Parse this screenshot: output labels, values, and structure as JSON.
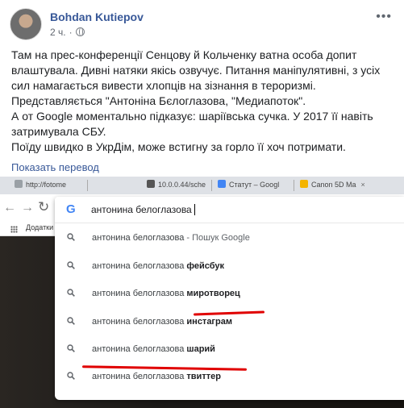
{
  "post": {
    "author": "Bohdan Kutiepov",
    "time": "2 ч.",
    "text_lines": [
      "Там на прес-конференції Сенцову й Кольченку ватна особа допит",
      "влаштувала. Дивні натяки якісь озвучує. Питання маніпулятивні, з усіх",
      "сил намагається вивести хлопців на зізнання в тероризмі.",
      "Представляється \"Антоніна Бєлоглазова, \"Медиапоток\".",
      "А от Google моментально підказує: шаріївська сучка. У 2017 її навіть",
      "затримувала СБУ.",
      "Поїду швидко в УкрДім, може встигну за горло її хоч потримати."
    ],
    "translate_link": "Показать перевод"
  },
  "browser": {
    "tabs": [
      "http://fotome",
      "10.0.0.44/sche",
      "Статут – Googl",
      "Canon 5D Ma"
    ],
    "bookmarks_label": "Додатки",
    "search_query": "антонина белоглазова",
    "suggestions": [
      {
        "base": "антонина белоглазова",
        "suffix": " - Пошук Google",
        "bold": ""
      },
      {
        "base": "антонина белоглазова ",
        "suffix": "",
        "bold": "фейсбук"
      },
      {
        "base": "антонина белоглазова ",
        "suffix": "",
        "bold": "миротворец"
      },
      {
        "base": "антонина белоглазова ",
        "suffix": "",
        "bold": "инстаграм"
      },
      {
        "base": "антонина белоглазова ",
        "suffix": "",
        "bold": "шарий"
      },
      {
        "base": "антонина белоглазова ",
        "suffix": "",
        "bold": "твиттер"
      }
    ]
  }
}
